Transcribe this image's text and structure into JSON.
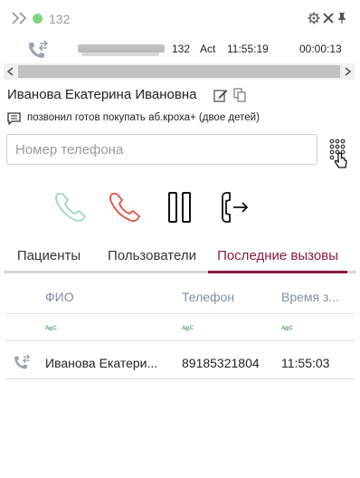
{
  "header": {
    "extension": "132",
    "status_color": "#7ed67e"
  },
  "call": {
    "ext": "132",
    "state": "Act",
    "time": "11:55:19",
    "duration": "00:00:13"
  },
  "contact": {
    "name": "Иванова Екатерина Ивановна",
    "comment": "позвонил готов покупать аб.кроха+ (двое детей)"
  },
  "phone": {
    "placeholder": "Номер телефона",
    "value": ""
  },
  "tabs": [
    {
      "label": "Пациенты"
    },
    {
      "label": "Пользователи"
    },
    {
      "label": "Последние вызовы",
      "active": true
    }
  ],
  "table": {
    "columns": [
      "ФИО",
      "Телефон",
      "Время з..."
    ],
    "rows": [
      {
        "name": "Иванова Екатери...",
        "phone": "89185321804",
        "time": "11:55:03"
      }
    ]
  },
  "colors": {
    "accent": "#8a1a46",
    "answer_green": "#9ed6c6",
    "hangup_red": "#e0523e"
  }
}
